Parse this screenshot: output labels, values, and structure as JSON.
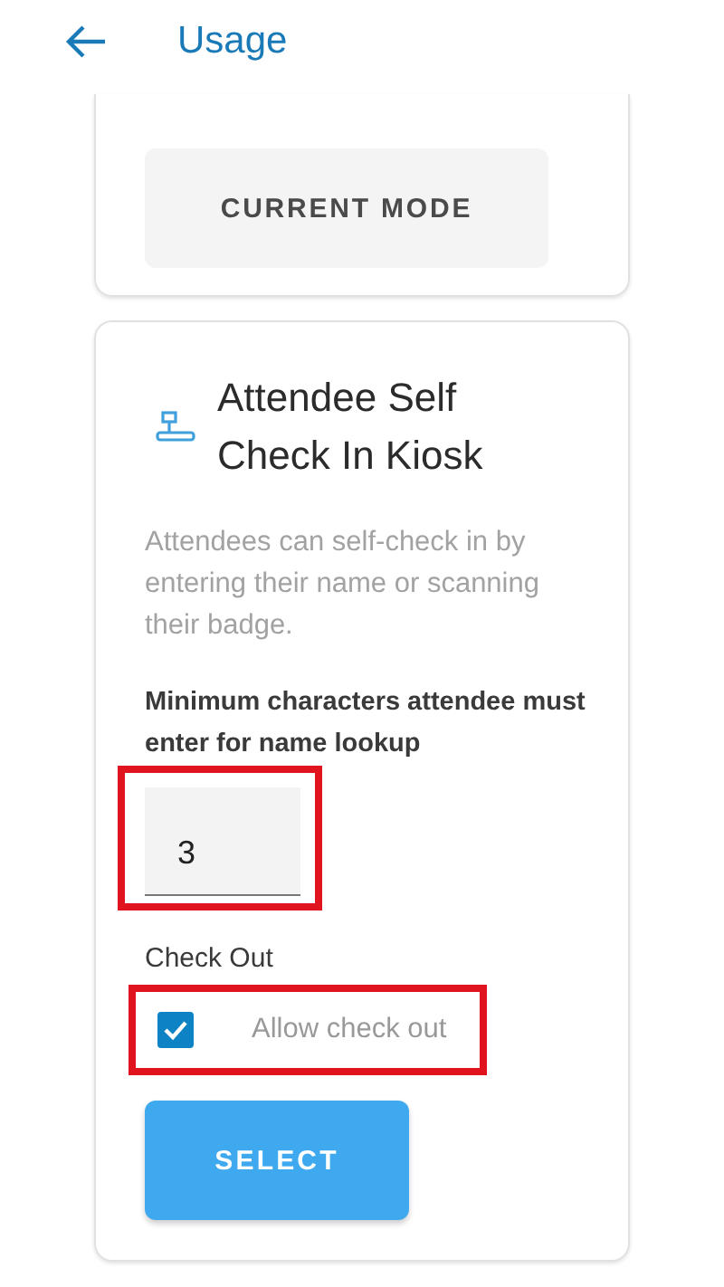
{
  "header": {
    "title": "Usage"
  },
  "current_card": {
    "button": "CURRENT MODE"
  },
  "kiosk_card": {
    "title": "Attendee Self Check In Kiosk",
    "description": "Attendees can self-check in by entering their name or scanning their badge.",
    "min_chars": {
      "label": "Minimum characters attendee must enter for name lookup",
      "value": "3",
      "highlighted": true
    },
    "check_out": {
      "heading": "Check Out",
      "label": "Allow check out",
      "checked": true,
      "highlighted": true
    },
    "button": "SELECT"
  }
}
